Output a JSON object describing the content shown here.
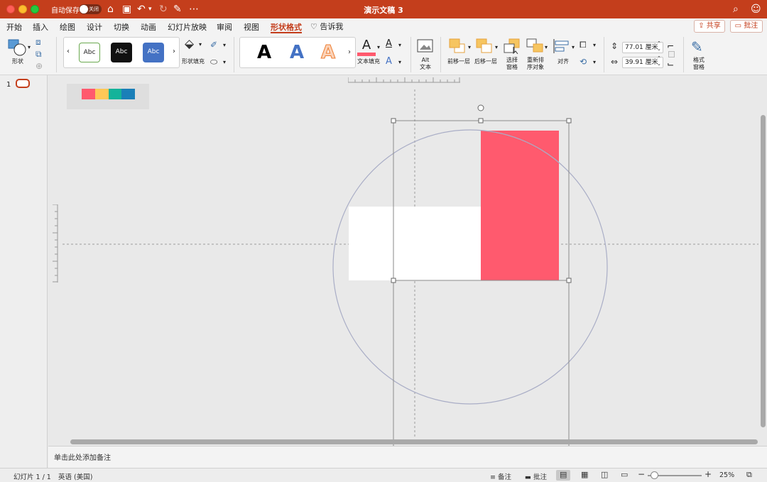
{
  "window": {
    "title": "演示文稿 3",
    "autosave_label": "自动保存",
    "autosave_state": "关闭"
  },
  "tabs": [
    {
      "label": "开始"
    },
    {
      "label": "插入"
    },
    {
      "label": "绘图"
    },
    {
      "label": "设计"
    },
    {
      "label": "切换"
    },
    {
      "label": "动画"
    },
    {
      "label": "幻灯片放映"
    },
    {
      "label": "审阅"
    },
    {
      "label": "视图"
    },
    {
      "label": "形状格式",
      "active": true
    }
  ],
  "tell_me": "告诉我",
  "share_label": "共享",
  "comment_label": "批注",
  "ribbon": {
    "shapes_label": "形状",
    "style_samples": [
      "Abc",
      "Abc",
      "Abc"
    ],
    "shape_fill_label": "形状填充",
    "wordart_samples": [
      "A",
      "A",
      "A"
    ],
    "text_fill_label": "文本填充",
    "alt_text_label_1": "Alt",
    "alt_text_label_2": "文本",
    "bring_forward_label": "前移一层",
    "send_backward_label": "后移一层",
    "selection_pane_label_1": "选择",
    "selection_pane_label_2": "窗格",
    "reorder_label_1": "重新排",
    "reorder_label_2": "序对象",
    "align_label": "对齐",
    "height_value": "77.01 厘米",
    "width_value": "39.91 厘米",
    "format_pane_label_1": "格式",
    "format_pane_label_2": "窗格"
  },
  "slides_panel": {
    "slide_number": "1"
  },
  "slide": {
    "palette_colors": [
      "#ff5a6e",
      "#ffc857",
      "#14b39a",
      "#1a7fb8"
    ],
    "red_rect_color": "#ff5a6e",
    "white_rect_color": "#ffffff",
    "circle_stroke": "#a9adc6"
  },
  "notes_placeholder": "单击此处添加备注",
  "status": {
    "slide_info": "幻灯片 1 / 1",
    "language": "英语 (美国)",
    "notes_label": "备注",
    "comments_label": "批注",
    "zoom": "25%"
  },
  "colors": {
    "accent": "#c43e1c"
  }
}
